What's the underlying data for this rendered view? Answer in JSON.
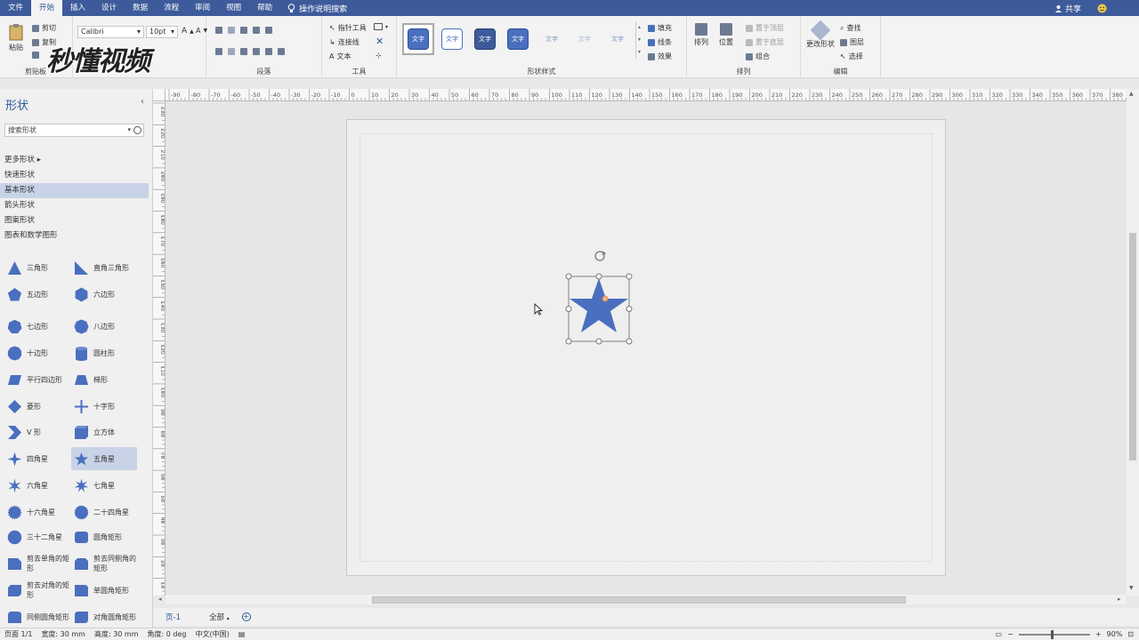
{
  "menu": {
    "items": [
      "文件",
      "开始",
      "插入",
      "设计",
      "数据",
      "流程",
      "审阅",
      "视图",
      "帮助"
    ],
    "active_index": 1,
    "tell_me": "操作说明搜索",
    "share": "共享"
  },
  "ribbon": {
    "clipboard": {
      "paste": "粘贴",
      "cut": "剪切",
      "copy": "复制",
      "label": "剪贴板"
    },
    "font": {
      "name": "Calibri",
      "size": "10pt"
    },
    "paragraph": {
      "label": "段落"
    },
    "tools": {
      "pointer": "指针工具",
      "connector": "连接线",
      "text": "文本",
      "label": "工具"
    },
    "shape_styles": {
      "sample": "文字",
      "label": "形状样式",
      "fill": "填充",
      "line": "线条",
      "effects": "效果"
    },
    "arrange": {
      "arrange": "排列",
      "position": "位置",
      "bring_front": "置于顶层",
      "send_back": "置于底层",
      "group": "组合",
      "label": "排列"
    },
    "editing": {
      "change_shape": "更改形状",
      "find": "查找",
      "layers": "图层",
      "select": "选择",
      "label": "编辑"
    },
    "watermark": "秒懂视频"
  },
  "pane": {
    "title": "形状",
    "search_placeholder": "搜索形状",
    "categories": [
      "更多形状",
      "快速形状",
      "基本形状",
      "箭头形状",
      "图案形状",
      "图表和数学图形"
    ],
    "active_category_index": 2,
    "shapes": [
      {
        "label": "三角形",
        "icon": "triangle-icon"
      },
      {
        "label": "直角三角形",
        "icon": "right-triangle-icon"
      },
      {
        "label": "五边形",
        "icon": "pentagon-icon"
      },
      {
        "label": "六边形",
        "icon": "hexagon-icon"
      },
      {
        "label": "七边形",
        "icon": "heptagon-icon"
      },
      {
        "label": "八边形",
        "icon": "octagon-icon"
      },
      {
        "label": "十边形",
        "icon": "decagon-icon"
      },
      {
        "label": "圆柱形",
        "icon": "cylinder-icon"
      },
      {
        "label": "平行四边形",
        "icon": "parallelogram-icon"
      },
      {
        "label": "梯形",
        "icon": "trapezoid-icon"
      },
      {
        "label": "菱形",
        "icon": "diamond-icon"
      },
      {
        "label": "十字形",
        "icon": "cross-icon"
      },
      {
        "label": "V 形",
        "icon": "chevron-icon"
      },
      {
        "label": "立方体",
        "icon": "cube-icon"
      },
      {
        "label": "四角星",
        "icon": "star4-icon"
      },
      {
        "label": "五角星",
        "icon": "star5-icon"
      },
      {
        "label": "六角星",
        "icon": "star6-icon"
      },
      {
        "label": "七角星",
        "icon": "star7-icon"
      },
      {
        "label": "十六角星",
        "icon": "star16-icon"
      },
      {
        "label": "二十四角星",
        "icon": "star24-icon"
      },
      {
        "label": "三十二角星",
        "icon": "star32-icon"
      },
      {
        "label": "圆角矩形",
        "icon": "rounded-rect-icon"
      },
      {
        "label": "剪去单角的矩形",
        "icon": "snip-one-corner-icon"
      },
      {
        "label": "剪去同侧角的矩形",
        "icon": "snip-same-side-icon"
      },
      {
        "label": "剪去对角的矩形",
        "icon": "snip-diagonal-icon"
      },
      {
        "label": "单圆角矩形",
        "icon": "round-one-corner-icon"
      },
      {
        "label": "同侧圆角矩形",
        "icon": "round-same-side-icon"
      },
      {
        "label": "对角圆角矩形",
        "icon": "round-diagonal-icon"
      }
    ],
    "active_shape_index": 15
  },
  "ruler": {
    "top_labels": [
      "-90",
      "-80",
      "-70",
      "-60",
      "-50",
      "-40",
      "-30",
      "-20",
      "-10",
      "0",
      "10",
      "20",
      "30",
      "40",
      "50",
      "60",
      "70",
      "80",
      "90",
      "100",
      "110",
      "120",
      "130",
      "140",
      "150",
      "160",
      "170",
      "180",
      "190",
      "200",
      "210",
      "220",
      "230",
      "240",
      "250",
      "260",
      "270",
      "280",
      "290",
      "300",
      "310",
      "320",
      "330",
      "340",
      "350",
      "360",
      "370",
      "380"
    ],
    "left_labels": [
      "230",
      "220",
      "210",
      "200",
      "190",
      "180",
      "170",
      "160",
      "150",
      "140",
      "130",
      "120",
      "110",
      "100",
      "90",
      "80",
      "70",
      "60",
      "50",
      "40",
      "30",
      "20",
      "10"
    ]
  },
  "tabs": {
    "page": "页-1",
    "all": "全部"
  },
  "status": {
    "page": "页面 1/1",
    "width": "宽度: 30 mm",
    "height": "高度: 30 mm",
    "angle": "角度: 0 deg",
    "lang": "中文(中国)",
    "zoom": "90%"
  },
  "colors": {
    "accent": "#2b579a",
    "shape_fill": "#4a6fbf",
    "title_bar": "#3d5a9a"
  }
}
